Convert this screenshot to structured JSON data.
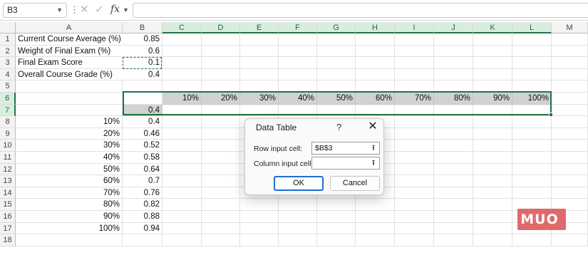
{
  "formula_bar": {
    "name_box": "B3",
    "fx_label": "fx",
    "formula": ""
  },
  "columns": [
    "A",
    "B",
    "C",
    "D",
    "E",
    "F",
    "G",
    "H",
    "I",
    "J",
    "K",
    "L",
    "M"
  ],
  "rows": [
    "1",
    "2",
    "3",
    "4",
    "5",
    "6",
    "7",
    "8",
    "9",
    "10",
    "11",
    "12",
    "13",
    "14",
    "15",
    "16",
    "17",
    "18"
  ],
  "labels": {
    "a1": "Current Course Average (%)",
    "a2": "Weight of Final Exam (%)",
    "a3": "Final Exam Score",
    "a4": "Overall Course Grade (%)"
  },
  "values": {
    "b1": "0.85",
    "b2": "0.6",
    "b3": "0.1",
    "b4": "0.4",
    "b7": "0.4"
  },
  "row6_headers": [
    "10%",
    "20%",
    "30%",
    "40%",
    "50%",
    "60%",
    "70%",
    "80%",
    "90%",
    "100%"
  ],
  "col_a_inputs": [
    "10%",
    "20%",
    "30%",
    "40%",
    "50%",
    "60%",
    "70%",
    "80%",
    "90%",
    "100%"
  ],
  "col_b_results": [
    "0.4",
    "0.46",
    "0.52",
    "0.58",
    "0.64",
    "0.7",
    "0.76",
    "0.82",
    "0.88",
    "0.94"
  ],
  "dialog": {
    "title": "Data Table",
    "help": "?",
    "close": "✕",
    "row_input_label": "Row input cell:",
    "row_input_value": "$B$3",
    "column_input_label": "Column input cell:",
    "column_input_value": "",
    "ok_label": "OK",
    "cancel_label": "Cancel",
    "picker_glyph": "⭱"
  },
  "watermark": "MUO",
  "colors": {
    "excel_green": "#217346",
    "shade": "#d2d2d2",
    "accent_blue": "#1f6fcf",
    "logo_red": "#e06a6a"
  }
}
